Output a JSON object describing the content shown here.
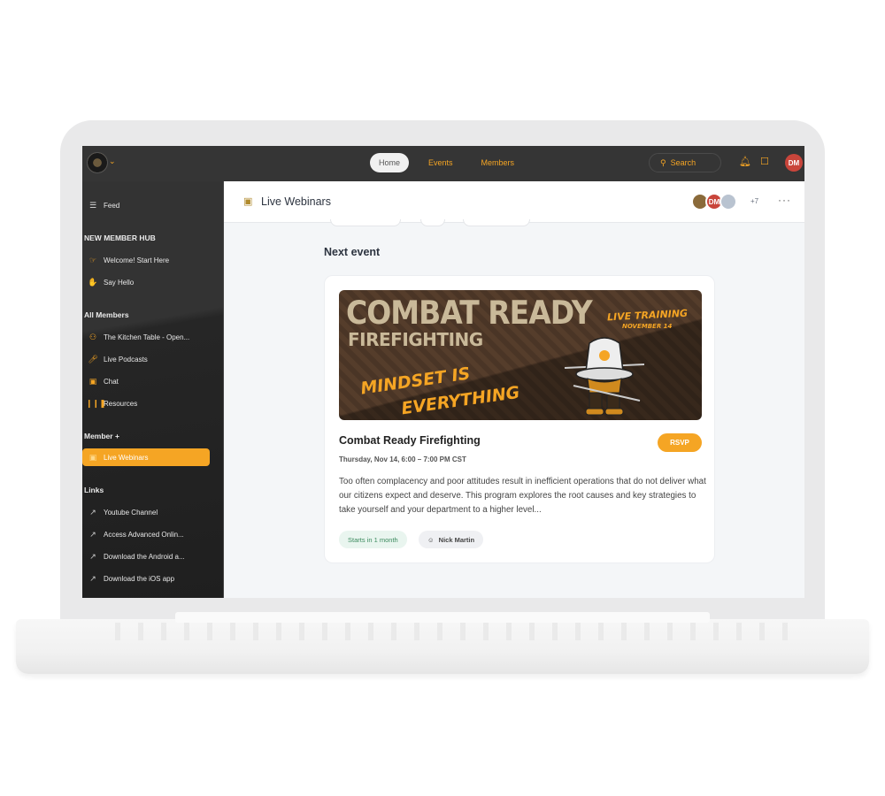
{
  "topbar": {
    "nav": [
      "Home",
      "Events",
      "Members"
    ],
    "active_nav": "Home",
    "search_label": "Search",
    "user_initials": "DM"
  },
  "sidebar": {
    "feed": "Feed",
    "sections": [
      {
        "title": "NEW MEMBER HUB",
        "items": [
          {
            "label": "Welcome! Start Here",
            "icon": "pointing-hand-icon"
          },
          {
            "label": "Say Hello",
            "icon": "waving-hand-icon"
          }
        ]
      },
      {
        "title": "All Members",
        "items": [
          {
            "label": "The Kitchen Table - Open...",
            "icon": "people-icon"
          },
          {
            "label": "Live Podcasts",
            "icon": "microphone-icon"
          },
          {
            "label": "Chat",
            "icon": "chat-bubble-icon"
          },
          {
            "label": "Resources",
            "icon": "books-icon"
          }
        ]
      },
      {
        "title": "Member +",
        "items": [
          {
            "label": "Live Webinars",
            "icon": "webinar-screen-icon",
            "active": true
          }
        ]
      },
      {
        "title": "Links",
        "items": [
          {
            "label": "Youtube Channel",
            "icon": "external-link-icon"
          },
          {
            "label": "Access Advanced Onlin...",
            "icon": "external-link-icon"
          },
          {
            "label": "Download the Android a...",
            "icon": "external-link-icon"
          },
          {
            "label": "Download the iOS app",
            "icon": "external-link-icon"
          }
        ]
      }
    ]
  },
  "header": {
    "title": "Live Webinars",
    "member_avatars": [
      "photo",
      "DM",
      "photo"
    ],
    "extra_members": "+7",
    "menu": "···"
  },
  "main": {
    "section_title": "Next event",
    "event": {
      "banner": {
        "line1": "COMBAT READY",
        "line2": "FIREFIGHTING",
        "line3": "MINDSET IS",
        "line4": "EVERYTHING",
        "live": "LIVE TRAINING",
        "date": "NOVEMBER 14"
      },
      "title": "Combat Ready Firefighting",
      "time": "Thursday, Nov 14, 6:00 – 7:00 PM CST",
      "rsvp": "RSVP",
      "description": "Too often complacency and poor attitudes result in inefficient operations that do not deliver what our citizens expect and deserve. This program explores the root causes and key strategies to take yourself and your department to a higher level...",
      "starts_in": "Starts in 1 month",
      "host": "Nick Martin"
    }
  },
  "colors": {
    "accent": "#f5a524",
    "topbar": "#353535",
    "avatar_red": "#c9453b"
  }
}
